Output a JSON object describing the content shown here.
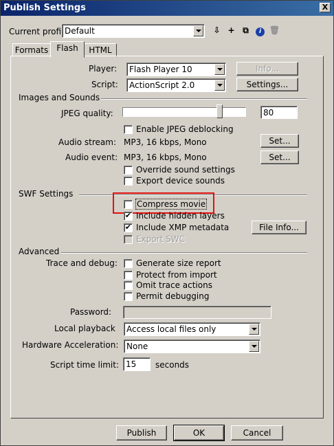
{
  "window": {
    "title": "Publish Settings",
    "close": "X"
  },
  "profile": {
    "label": "Current profile:",
    "value": "Default",
    "tools": [
      "import-export-icon",
      "add-profile-icon",
      "duplicate-profile-icon",
      "profile-info-icon",
      "delete-profile-icon"
    ]
  },
  "tabs": [
    "Formats",
    "Flash",
    "HTML"
  ],
  "player": {
    "label": "Player:",
    "value": "Flash Player 10",
    "info_button": "Info..."
  },
  "script": {
    "label": "Script:",
    "value": "ActionScript 2.0",
    "settings_button": "Settings..."
  },
  "images_sounds": {
    "heading": "Images and Sounds",
    "jpeg_label": "JPEG quality:",
    "jpeg_value": "80",
    "jpeg_fraction": 0.8,
    "deblocking": {
      "label": "Enable JPEG deblocking",
      "checked": false
    },
    "audio_stream": {
      "label": "Audio stream:",
      "value": "MP3, 16 kbps, Mono",
      "button": "Set..."
    },
    "audio_event": {
      "label": "Audio event:",
      "value": "MP3, 16 kbps, Mono",
      "button": "Set..."
    },
    "override_sound": {
      "label": "Override sound settings",
      "checked": false
    },
    "export_device": {
      "label": "Export device sounds",
      "checked": false
    }
  },
  "swf": {
    "heading": "SWF Settings",
    "compress": {
      "label": "Compress movie",
      "checked": false
    },
    "hidden_layers": {
      "label": "Include hidden layers",
      "checked": true
    },
    "xmp": {
      "label": "Include XMP metadata",
      "checked": true
    },
    "file_info_button": "File Info...",
    "export_swc": {
      "label": "Export SWC",
      "checked": false
    }
  },
  "advanced": {
    "heading": "Advanced",
    "trace_label": "Trace and debug:",
    "size_report": {
      "label": "Generate size report",
      "checked": false
    },
    "protect": {
      "label": "Protect from import",
      "checked": false
    },
    "omit_trace": {
      "label": "Omit trace actions",
      "checked": false
    },
    "permit_debug": {
      "label": "Permit debugging",
      "checked": false
    },
    "password_label": "Password:",
    "password_value": "",
    "local_playback_label": "Local playback",
    "local_playback_value": "Access local files only",
    "hw_accel_label": "Hardware Acceleration:",
    "hw_accel_value": "None",
    "time_limit_label": "Script time limit:",
    "time_limit_value": "15",
    "time_limit_unit": "seconds"
  },
  "footer": {
    "publish": "Publish",
    "ok": "OK",
    "cancel": "Cancel"
  },
  "colors": {
    "title_bar": "#0a246a",
    "highlight": "#e01010",
    "face": "#d4d0c8"
  }
}
